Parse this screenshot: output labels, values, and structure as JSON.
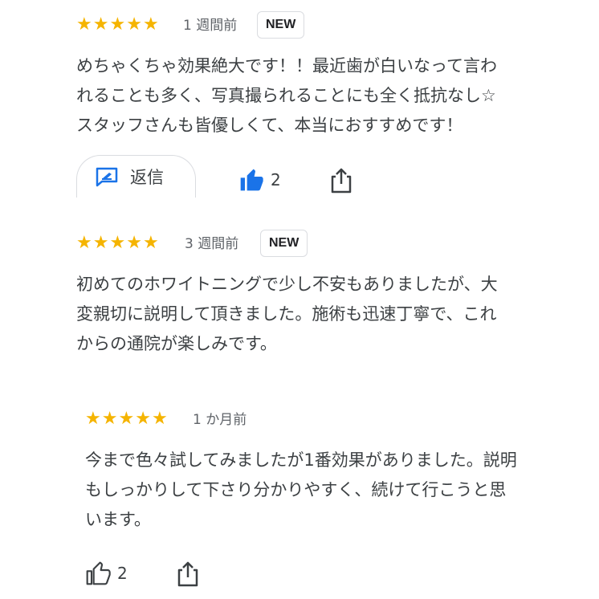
{
  "reviews": [
    {
      "stars": 5,
      "star_glyphs": [
        "★",
        "★",
        "★",
        "★",
        "★"
      ],
      "time": "1 週間前",
      "badge": "NEW",
      "text": "めちゃくちゃ効果絶大です！！最近歯が白いなって言わ\nれることも多く、写真撮られることにも全く抵抗なし☆\nスタッフさんも皆優しくて、本当におすすめです！",
      "reply_label": "返信",
      "likes": "2",
      "liked": true
    },
    {
      "stars": 5,
      "star_glyphs": [
        "★",
        "★",
        "★",
        "★",
        "★"
      ],
      "time": "3 週間前",
      "badge": "NEW",
      "text": "初めてのホワイトニングで少し不安もありましたが、大\n変親切に説明して頂きました。施術も迅速丁寧で、これ\nからの通院が楽しみです。"
    },
    {
      "stars": 5,
      "star_glyphs": [
        "★",
        "★",
        "★",
        "★",
        "★"
      ],
      "time": "1 か月前",
      "text": "今まで色々試してみましたが1番効果がありました。説明\nもしっかりして下さり分かりやすく、続けて行こうと思\nいます。",
      "likes": "2",
      "liked": false
    }
  ],
  "colors": {
    "star": "#f5b400",
    "like_active": "#1a73e8",
    "reply_icon": "#1a73e8",
    "icon": "#3c4043"
  },
  "icons": {
    "reply": "reply-icon",
    "like": "thumbs-up-icon",
    "share": "share-icon"
  }
}
